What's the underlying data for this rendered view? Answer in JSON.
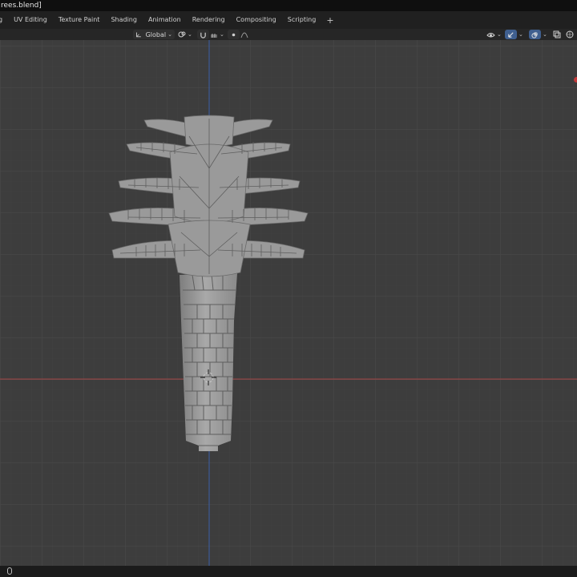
{
  "window": {
    "title": "rees.blend]"
  },
  "workspace_tabs": [
    {
      "label": "g"
    },
    {
      "label": "UV Editing"
    },
    {
      "label": "Texture Paint"
    },
    {
      "label": "Shading"
    },
    {
      "label": "Animation"
    },
    {
      "label": "Rendering"
    },
    {
      "label": "Compositing"
    },
    {
      "label": "Scripting"
    }
  ],
  "add_workspace_label": "+",
  "header": {
    "orientation_value": "Global"
  },
  "icons": {
    "transform_orientation": "axes-icon",
    "pivot": "link-icon",
    "snap": "magnet-icon",
    "snap_increment": "grid-snap-icon",
    "proportional": "proportional-edit-icon",
    "falloff": "falloff-curve-icon",
    "visibility": "eye-icon",
    "gizmo": "gizmo-icon",
    "overlays": "overlay-icon",
    "xray": "xray-icon",
    "shading": "wireframe-icon",
    "status_mouse": "mouse-icon"
  },
  "colors": {
    "viewport_bg": "#3d3d3d",
    "x_axis": "#a34545",
    "y_axis": "#3b5ea8",
    "mesh": "#9a9a9a"
  }
}
